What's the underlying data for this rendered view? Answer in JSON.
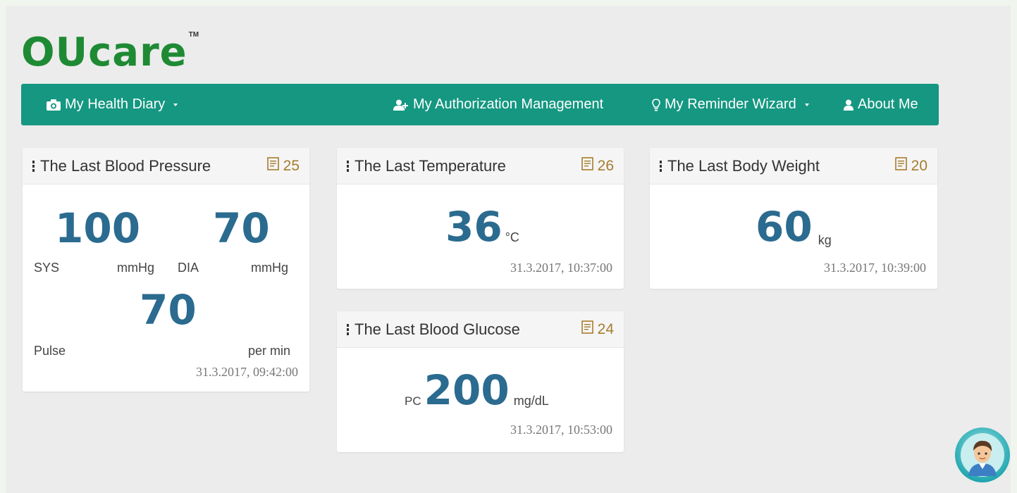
{
  "logo": {
    "text": "OUcare",
    "tm": "TM"
  },
  "nav": {
    "health_diary": "My Health Diary",
    "authorization": "My Authorization Management",
    "reminder": "My Reminder Wizard",
    "about": "About Me"
  },
  "cards": {
    "bp": {
      "title": "The Last Blood Pressure",
      "count": "25",
      "sys": "100",
      "dia": "70",
      "sys_label": "SYS",
      "sys_unit": "mmHg",
      "dia_label": "DIA",
      "dia_unit": "mmHg",
      "pulse": "70",
      "pulse_label": "Pulse",
      "pulse_unit": "per min",
      "timestamp": "31.3.2017, 09:42:00"
    },
    "temp": {
      "title": "The Last Temperature",
      "count": "26",
      "value": "36",
      "unit": "°C",
      "timestamp": "31.3.2017, 10:37:00"
    },
    "weight": {
      "title": "The Last Body Weight",
      "count": "20",
      "value": "60",
      "unit": "kg",
      "timestamp": "31.3.2017, 10:39:00"
    },
    "glucose": {
      "title": "The Last Blood Glucose",
      "count": "24",
      "prefix": "PC",
      "value": "200",
      "unit": "mg/dL",
      "timestamp": "31.3.2017, 10:53:00"
    }
  },
  "colors": {
    "nav_bg": "#159781",
    "value_blue": "#2b6b8f",
    "count_gold": "#a67c2d",
    "logo_green": "#1f8a34"
  },
  "icons": [
    "camera-icon",
    "user-plus-icon",
    "lightbulb-icon",
    "user-icon",
    "document-icon",
    "vertical-dots-icon",
    "chevron-down-icon",
    "avatar-icon"
  ]
}
